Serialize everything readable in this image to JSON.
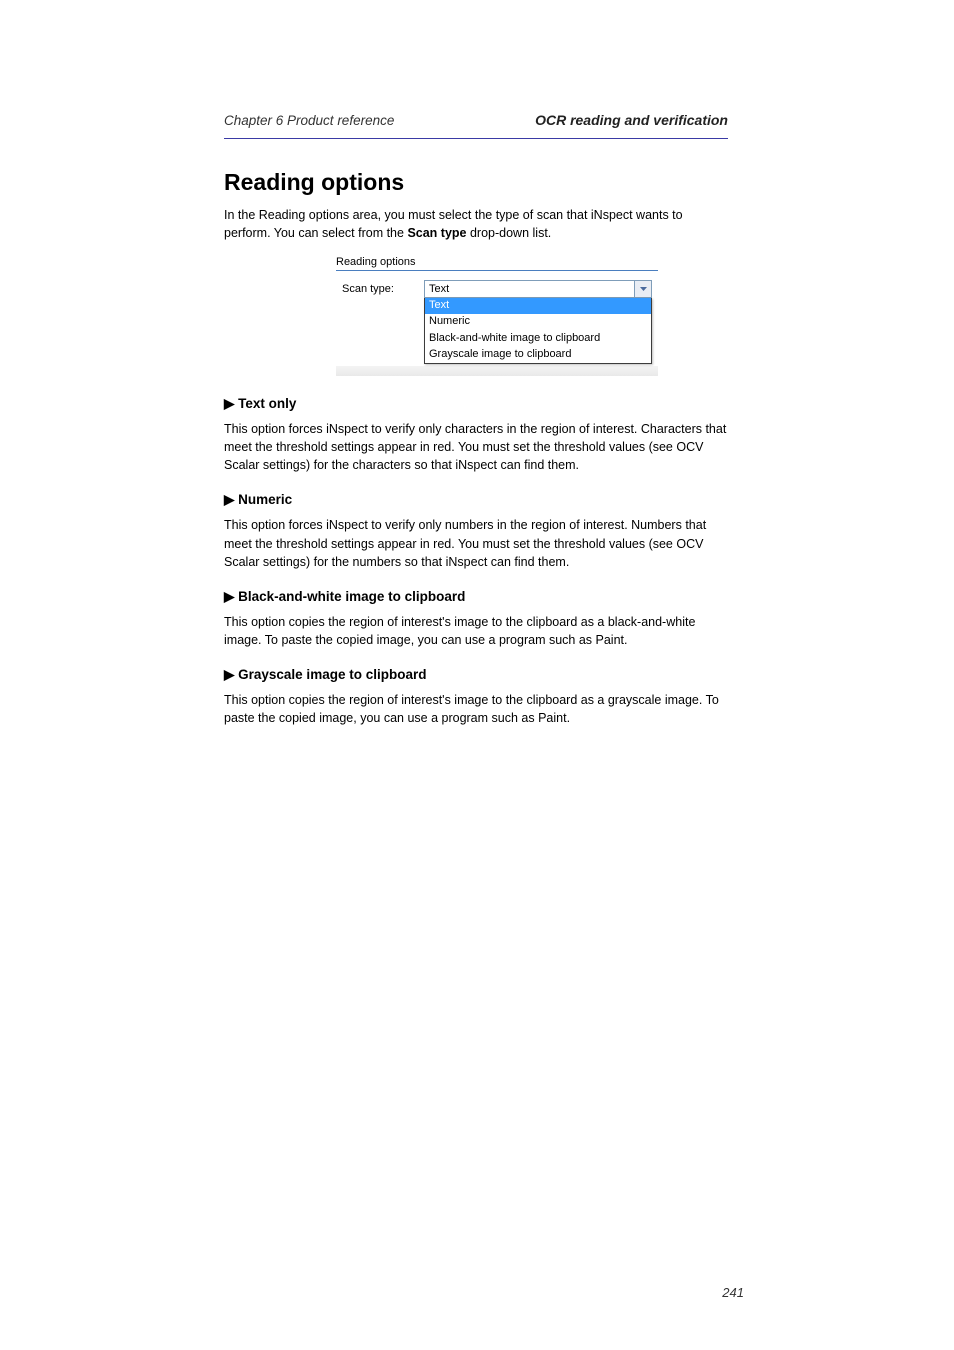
{
  "header": {
    "chapter_title": "Chapter 6      Product reference",
    "section_caption": "OCR reading and verification"
  },
  "section": {
    "title": "Reading options",
    "intro": "In the Reading options area, you must select the type of scan that iNspect wants to perform. You can select from the Scan type drop-down list.",
    "scan_type_label": "Scan type"
  },
  "figure": {
    "group_label": "Reading options",
    "row_label": "Scan type:",
    "combo_value": "Text",
    "options": [
      "Text",
      "Numeric",
      "Black-and-white image to clipboard",
      "Grayscale image to clipboard"
    ],
    "selected_index": 0
  },
  "options_detail": {
    "text_only": {
      "title": "▶  Text only",
      "body": "This option forces iNspect to verify only characters in the region of interest. Characters that meet the threshold settings appear in red. You must set the threshold values (see OCV Scalar settings) for the characters so that iNspect can find them."
    },
    "numeric": {
      "title": "▶  Numeric",
      "body": "This option forces iNspect to verify only numbers in the region of interest. Numbers that meet the threshold settings appear in red. You must set the threshold values (see OCV Scalar settings) for the numbers so that iNspect can find them."
    },
    "bw_clipboard": {
      "title": "▶  Black-and-white image to clipboard",
      "body": "This option copies the region of interest's image to the clipboard as a black-and-white image. To paste the copied image, you can use a program such as Paint."
    },
    "gray_clipboard": {
      "title": "▶  Grayscale image to clipboard",
      "body": "This option copies the region of interest's image to the clipboard as a grayscale image. To paste the copied image, you can use a program such as Paint."
    }
  },
  "footer": {
    "page_number": "241"
  }
}
